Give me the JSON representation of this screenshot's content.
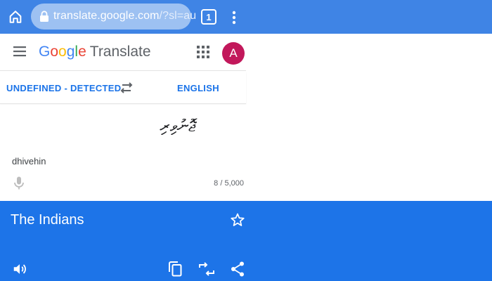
{
  "browser": {
    "url_host": "translate.google.com",
    "url_rest": "/?sl=au",
    "tab_count": "1",
    "home_icon": "home-icon",
    "lock_icon": "lock-icon",
    "menu_icon": "more-vert-icon"
  },
  "header": {
    "logo_letters": [
      "G",
      "o",
      "o",
      "g",
      "l",
      "e"
    ],
    "product": "Translate",
    "avatar_letter": "A",
    "avatar_color": "#c2185b",
    "menu_icon": "hamburger-icon",
    "apps_icon": "apps-grid-icon"
  },
  "languages": {
    "source": "UNDEFINED - DETECTED",
    "target": "ENGLISH",
    "swap_icon": "swap-icon"
  },
  "source": {
    "text": "ޖޮނުވިރި",
    "detected_language": "dhivehin",
    "char_count": "8 / 5,000",
    "mic_icon": "mic-icon"
  },
  "result": {
    "text": "The Indians",
    "star_icon": "star-icon",
    "speaker_icon": "speaker-icon",
    "copy_icon": "copy-icon",
    "reverse_icon": "reverse-translate-icon",
    "share_icon": "share-icon"
  },
  "colors": {
    "chrome_bar": "#3f84e5",
    "accent_blue": "#1a73e8",
    "result_background": "#1d74e8"
  }
}
